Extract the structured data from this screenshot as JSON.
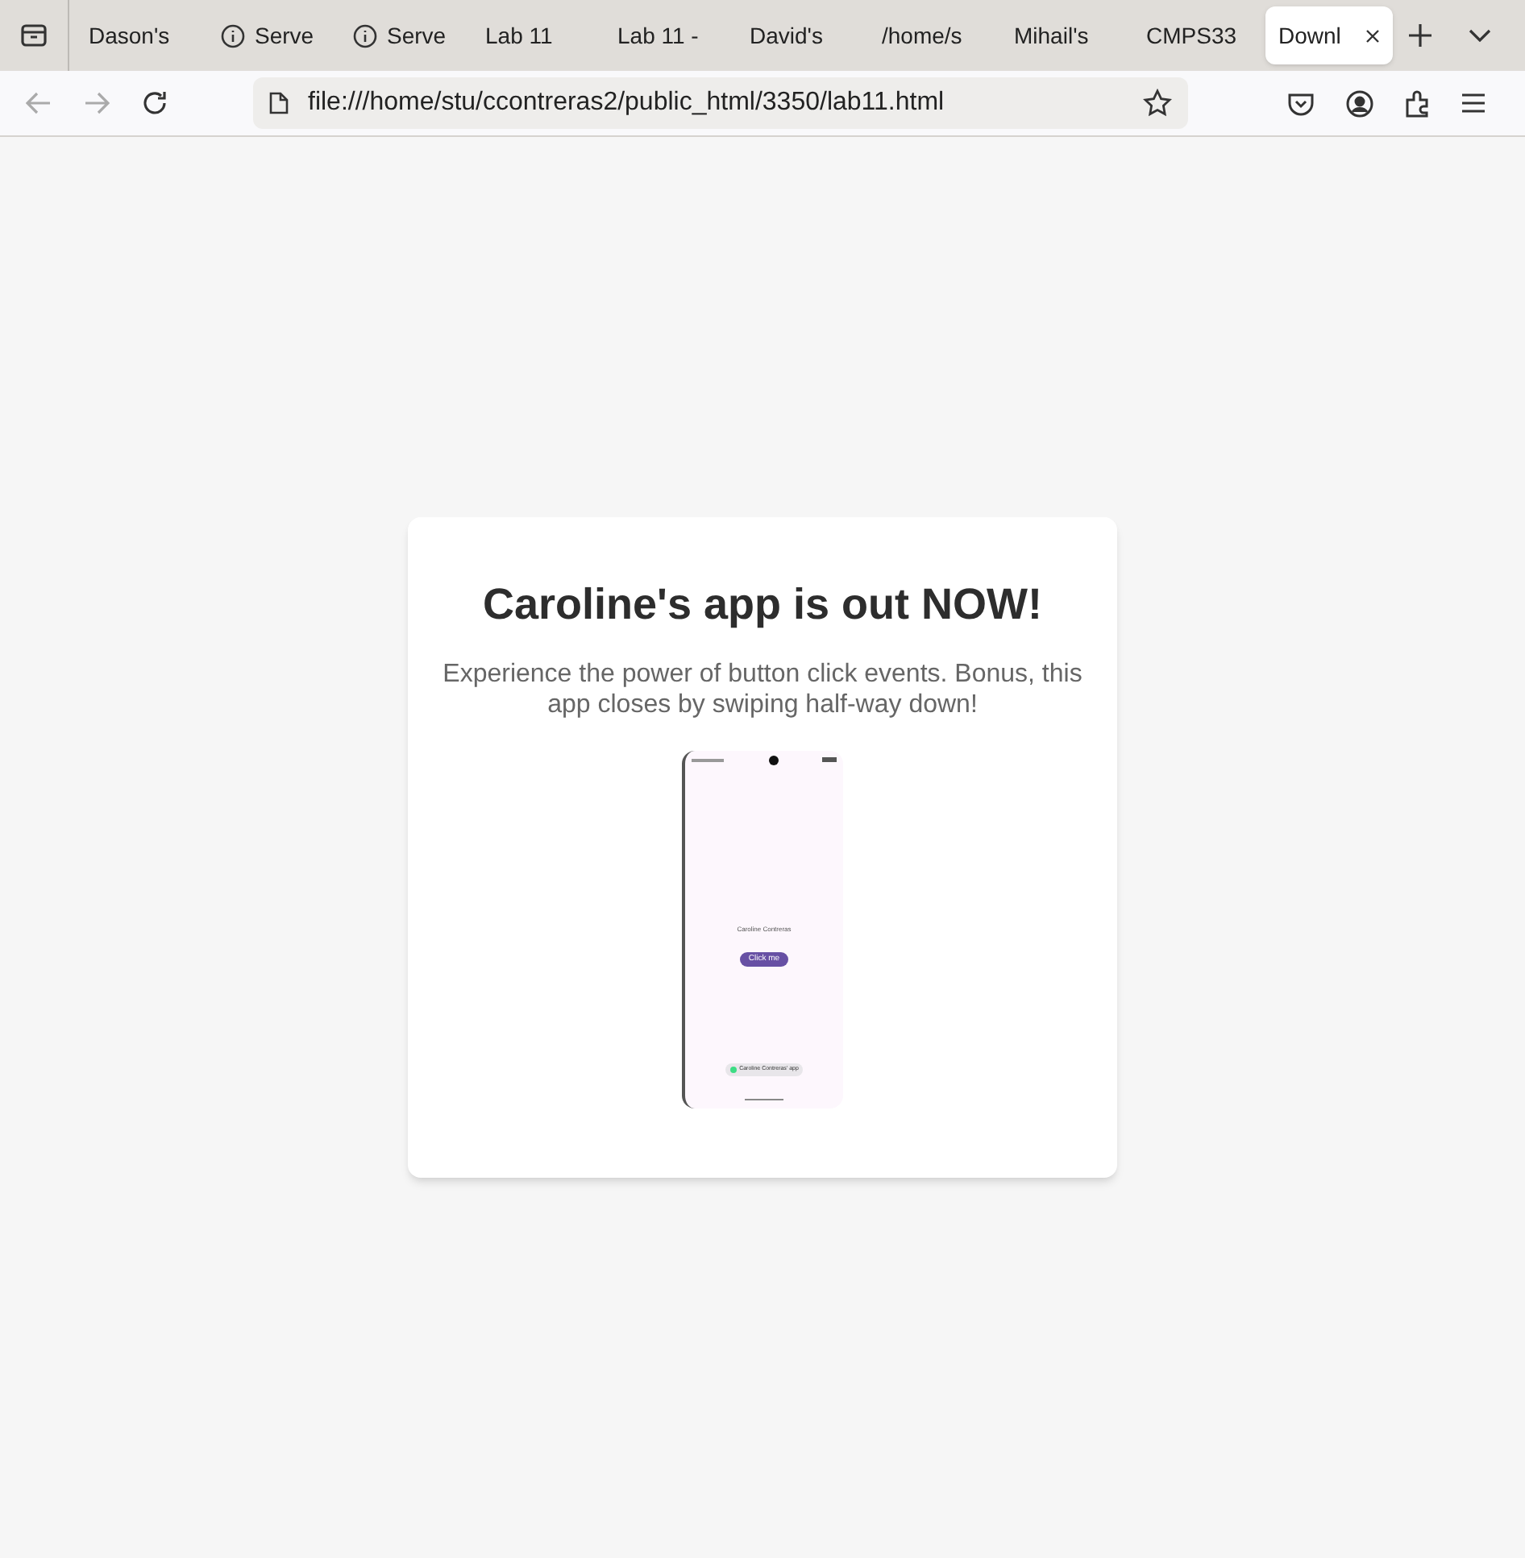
{
  "tabs": [
    {
      "label": "Dason's",
      "kind": "plain",
      "selected": false
    },
    {
      "label": "Serve",
      "kind": "info",
      "selected": false
    },
    {
      "label": "Serve",
      "kind": "info",
      "selected": false
    },
    {
      "label": "Lab 11",
      "kind": "plain",
      "selected": false
    },
    {
      "label": "Lab 11 -",
      "kind": "plain",
      "selected": false
    },
    {
      "label": "David's",
      "kind": "plain",
      "selected": false
    },
    {
      "label": "/home/s",
      "kind": "plain",
      "selected": false
    },
    {
      "label": "Mihail's",
      "kind": "plain",
      "selected": false
    },
    {
      "label": "CMPS33",
      "kind": "plain",
      "selected": false
    },
    {
      "label": "Downl",
      "kind": "plain",
      "selected": true
    }
  ],
  "address_bar": {
    "url": "file:///home/stu/ccontreras2/public_html/3350/lab11.html"
  },
  "card": {
    "heading": "Caroline's app is out NOW!",
    "description": "Experience the power of button click events. Bonus, this app closes by swiping half-way down!",
    "phone_screenshot": {
      "name_label": "Caroline Contreras",
      "button": "Click me",
      "toast": "Caroline Contreras' app"
    }
  }
}
